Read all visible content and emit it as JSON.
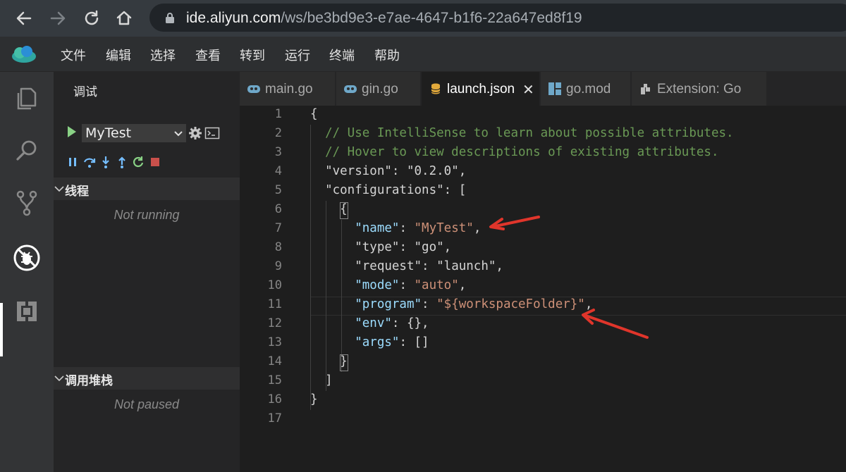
{
  "browser": {
    "url_host": "ide.aliyun.com",
    "url_path": "/ws/be3bd9e3-e7ae-4647-b1f6-22a647ed8f19"
  },
  "menu": [
    "文件",
    "编辑",
    "选择",
    "查看",
    "转到",
    "运行",
    "终端",
    "帮助"
  ],
  "sidebar": {
    "title": "调试",
    "config_name": "MyTest",
    "threads": {
      "title": "线程",
      "status": "Not running"
    },
    "callstack": {
      "title": "调用堆栈",
      "status": "Not paused"
    }
  },
  "tabs": [
    {
      "label": "main.go",
      "icon": "go-file-icon",
      "active": false
    },
    {
      "label": "gin.go",
      "icon": "go-file-icon",
      "active": false
    },
    {
      "label": "launch.json",
      "icon": "json-file-icon",
      "active": true,
      "close": "✕"
    },
    {
      "label": "go.mod",
      "icon": "module-file-icon",
      "active": false
    },
    {
      "label": "Extension: Go",
      "icon": "extension-icon",
      "active": false
    }
  ],
  "editor": {
    "line_numbers": [
      "1",
      "2",
      "3",
      "4",
      "5",
      "6",
      "7",
      "8",
      "9",
      "10",
      "11",
      "12",
      "13",
      "14",
      "15",
      "16",
      "17"
    ],
    "lines": [
      [
        {
          "t": "{",
          "c": "plain"
        }
      ],
      [
        {
          "t": "  // Use IntelliSense to learn about possible attributes.",
          "c": "comment"
        }
      ],
      [
        {
          "t": "  // Hover to view descriptions of existing attributes.",
          "c": "comment"
        }
      ],
      [
        {
          "t": "  \"version\"",
          "c": "plain"
        },
        {
          "t": ": ",
          "c": "plain"
        },
        {
          "t": "\"0.2.0\"",
          "c": "plain"
        },
        {
          "t": ",",
          "c": "plain"
        }
      ],
      [
        {
          "t": "  \"configurations\"",
          "c": "plain"
        },
        {
          "t": ": [",
          "c": "plain"
        }
      ],
      [
        {
          "t": "    {",
          "c": "plain"
        }
      ],
      [
        {
          "t": "      \"name\"",
          "c": "key"
        },
        {
          "t": ": ",
          "c": "plain"
        },
        {
          "t": "\"MyTest\"",
          "c": "str"
        },
        {
          "t": ",",
          "c": "plain"
        }
      ],
      [
        {
          "t": "      \"type\"",
          "c": "plain"
        },
        {
          "t": ": ",
          "c": "plain"
        },
        {
          "t": "\"go\"",
          "c": "plain"
        },
        {
          "t": ",",
          "c": "plain"
        }
      ],
      [
        {
          "t": "      \"request\"",
          "c": "plain"
        },
        {
          "t": ": ",
          "c": "plain"
        },
        {
          "t": "\"launch\"",
          "c": "plain"
        },
        {
          "t": ",",
          "c": "plain"
        }
      ],
      [
        {
          "t": "      \"mode\"",
          "c": "key"
        },
        {
          "t": ": ",
          "c": "plain"
        },
        {
          "t": "\"auto\"",
          "c": "str"
        },
        {
          "t": ",",
          "c": "plain"
        }
      ],
      [
        {
          "t": "      \"program\"",
          "c": "key"
        },
        {
          "t": ": ",
          "c": "plain"
        },
        {
          "t": "\"${workspaceFolder}\"",
          "c": "str"
        },
        {
          "t": ",",
          "c": "plain"
        }
      ],
      [
        {
          "t": "      \"env\"",
          "c": "key"
        },
        {
          "t": ": {},",
          "c": "plain"
        }
      ],
      [
        {
          "t": "      \"args\"",
          "c": "key"
        },
        {
          "t": ": []",
          "c": "plain"
        }
      ],
      [
        {
          "t": "    }",
          "c": "plain"
        }
      ],
      [
        {
          "t": "  ]",
          "c": "plain"
        }
      ],
      [
        {
          "t": "}",
          "c": "plain"
        }
      ],
      [
        {
          "t": "",
          "c": "plain"
        }
      ]
    ]
  },
  "colors": {
    "comment": "#6a9955",
    "key": "#9cdcfe",
    "string": "#ce9178",
    "annotation_arrow": "#e0352b"
  }
}
